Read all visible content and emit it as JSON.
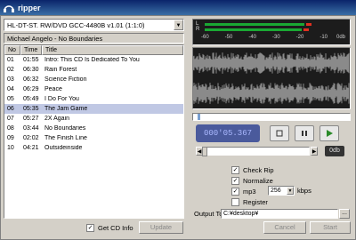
{
  "window": {
    "title": "ripper"
  },
  "drive": {
    "selected": "HL-DT-ST. RW/DVD GCC-4480B v1.01 (1:1:0)"
  },
  "album": {
    "label": "Michael Angelo - No Boundaries"
  },
  "tracklist": {
    "columns": [
      "No",
      "Time",
      "Title"
    ],
    "rows": [
      {
        "no": "01",
        "time": "01:55",
        "title": "Intro: This CD Is Dedicated To You"
      },
      {
        "no": "02",
        "time": "06:30",
        "title": "Rain Forest"
      },
      {
        "no": "03",
        "time": "06:32",
        "title": "Science Fiction"
      },
      {
        "no": "04",
        "time": "06:29",
        "title": "Peace"
      },
      {
        "no": "05",
        "time": "05:49",
        "title": "I Do For You"
      },
      {
        "no": "06",
        "time": "05:35",
        "title": "The Jam Game"
      },
      {
        "no": "07",
        "time": "05:27",
        "title": "2X Again"
      },
      {
        "no": "08",
        "time": "03:44",
        "title": "No Boundaries"
      },
      {
        "no": "09",
        "time": "02:02",
        "title": "The Finish Line"
      },
      {
        "no": "10",
        "time": "04:21",
        "title": "Outsideinside"
      }
    ],
    "selected_index": 5
  },
  "meter": {
    "left_label": "L",
    "right_label": "R",
    "scale": [
      "-60",
      "-50",
      "-40",
      "-30",
      "-20",
      "-10",
      "0db"
    ],
    "left_level": 0.7,
    "right_level": 0.68
  },
  "player": {
    "time": "000'05.367",
    "stop_icon": "stop-icon",
    "pause_icon": "pause-icon",
    "play_icon": "play-icon",
    "gain": "0db",
    "position": 0.02,
    "volume": 0.0
  },
  "options": {
    "check_rip": {
      "label": "Check Rip",
      "checked": true
    },
    "normalize": {
      "label": "Normalize",
      "checked": true
    },
    "mp3": {
      "label": "mp3",
      "checked": true
    },
    "bitrate": "256",
    "bitrate_unit": "kbps",
    "register": {
      "label": "Register",
      "checked": false
    },
    "output_label": "Output To",
    "output_path": "C:¥desktop¥",
    "browse": "..."
  },
  "footer": {
    "get_cd_info": {
      "label": "Get CD Info",
      "checked": true
    },
    "update": "Update",
    "cancel": "Cancel",
    "start": "Start"
  },
  "colors": {
    "meter_bar": "#1aa833",
    "peak": "#e03020",
    "time_display": "#4a5a9c",
    "selection": "#c0c8e4"
  }
}
